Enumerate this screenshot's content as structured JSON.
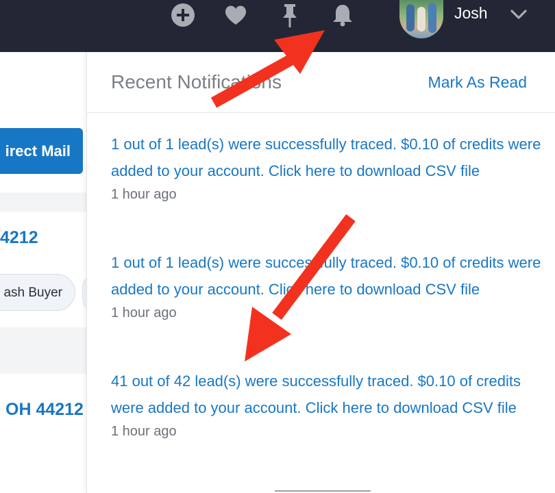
{
  "topbar": {
    "icons": [
      "plus-circle-icon",
      "heart-icon",
      "pin-icon",
      "bell-icon"
    ],
    "user_name": "Josh"
  },
  "background_page": {
    "direct_mail_button": "irect Mail",
    "zip_partial": "4212",
    "chip_label": "ash Buyer",
    "zip_full": "OH 44212"
  },
  "notifications_panel": {
    "title": "Recent Notifications",
    "mark_as_read": "Mark As Read",
    "items": [
      {
        "text": "1 out of 1 lead(s) were successfully traced. $0.10 of credits were added to your account. Click here to download CSV file",
        "time": "1 hour ago"
      },
      {
        "text": "1 out of 1 lead(s) were successfully traced. $0.10 of credits were added to your account. Click here to download CSV file",
        "time": "1 hour ago"
      },
      {
        "text": "41 out of 42 lead(s) were successfully traced. $0.10 of credits were added to your account. Click here to download CSV file",
        "time": "1 hour ago"
      }
    ]
  },
  "colors": {
    "topbar_bg": "#232735",
    "link_blue": "#1877c5",
    "annotation_red": "#f2321f",
    "icon_gray": "#a9adb3"
  }
}
